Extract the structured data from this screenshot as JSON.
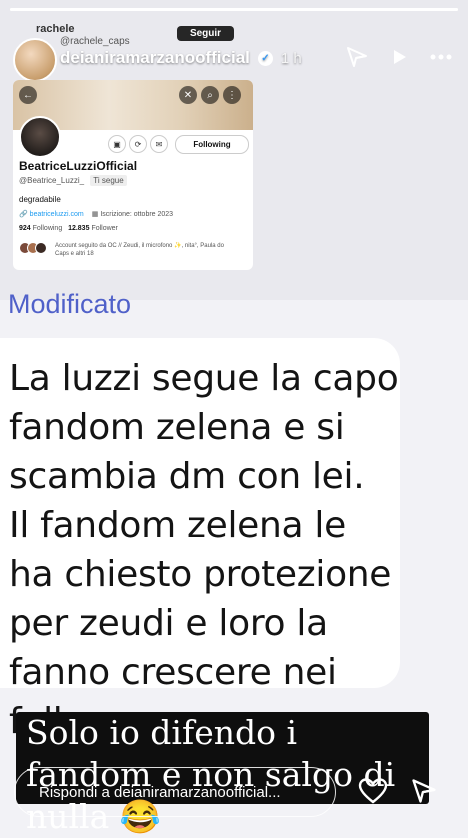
{
  "story": {
    "username": "deianiramarzanoofficial",
    "time": "1 h",
    "progress": 1.0
  },
  "header_icons": {
    "send": "paper-plane-icon",
    "play": "play-icon",
    "more": "ellipsis-icon"
  },
  "embedded_story": {
    "username": "rachele",
    "tag": "@rachele_caps",
    "follow_label": "Seguir"
  },
  "twitter_card": {
    "display_name": "BeatriceLuzziOfficial",
    "handle": "@Beatrice_Luzzi_",
    "follows_you": "Ti segue",
    "bio": "degradabile",
    "website": "beatriceluzzi.com",
    "joined": "Iscrizione: ottobre 2023",
    "following_count": "924",
    "following_label": "Following",
    "follower_count": "12.835",
    "follower_label": "Follower",
    "following_button": "Following",
    "mutuals_text": "Account seguito da OC // Zeudi, il microfono ✨, nita°, Paula do Caps e altri 18"
  },
  "edited_label": "Modificato",
  "message": {
    "lines": [
      "La luzzi segue la capo fandom zelena e si scambia dm con lei.",
      "Il fandom zelena le ha chiesto protezione per zeudi e loro la fanno crescere nei follower"
    ]
  },
  "caption": {
    "text": "Solo io difendo i fandom e non salgo di nulla 😂"
  },
  "reply": {
    "placeholder": "Rispondi a deianiramarzanoofficial..."
  },
  "colors": {
    "edited_label": "#5061c9",
    "caption_bg": "#0e0e0e"
  }
}
